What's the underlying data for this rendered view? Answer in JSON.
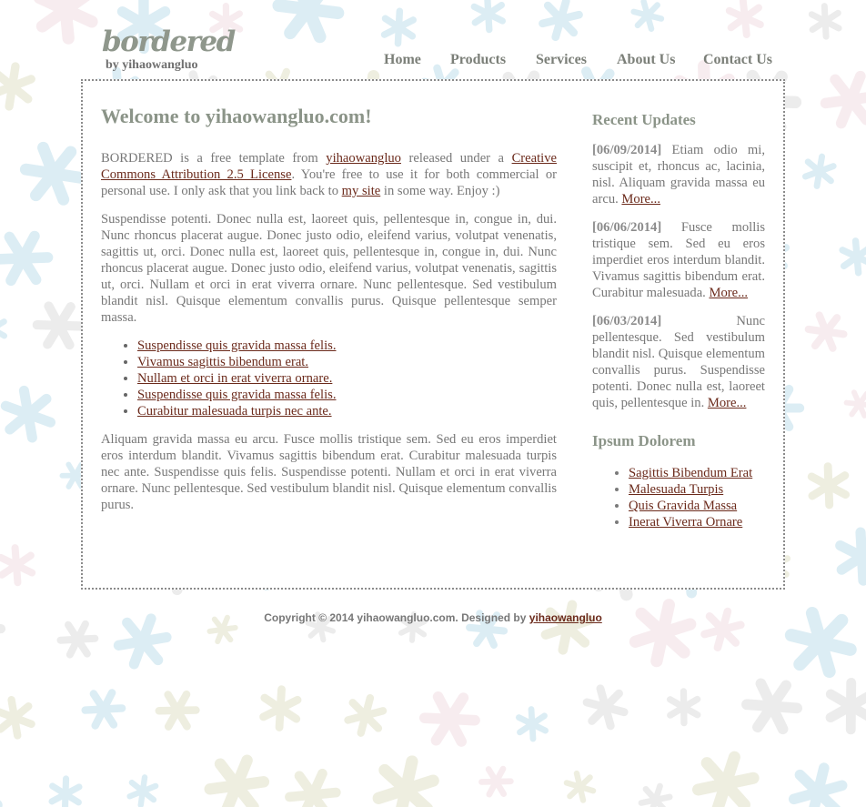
{
  "site": {
    "logo_title": "bordered",
    "logo_subtitle": "by yihaowangluo"
  },
  "nav": {
    "items": [
      {
        "label": "Home"
      },
      {
        "label": "Products"
      },
      {
        "label": "Services"
      },
      {
        "label": "About Us"
      },
      {
        "label": "Contact Us"
      }
    ]
  },
  "main": {
    "heading": "Welcome to yihaowangluo.com!",
    "intro": {
      "t1": "BORDERED is a free template from ",
      "link1": "yihaowangluo",
      "t2": " released under a ",
      "link2": "Creative Commons Attribution 2.5 License",
      "t3": ". You're free to use it for both commercial or personal use. I only ask that you link back to ",
      "link3": "my site",
      "t4": " in some way. Enjoy :)"
    },
    "paragraph2": "Suspendisse potenti. Donec nulla est, laoreet quis, pellentesque in, congue in, dui. Nunc rhoncus placerat augue. Donec justo odio, eleifend varius, volutpat venenatis, sagittis ut, orci. Donec nulla est, laoreet quis, pellentesque in, congue in, dui. Nunc rhoncus placerat augue. Donec justo odio, eleifend varius, volutpat venenatis, sagittis ut, orci. Nullam et orci in erat viverra ornare. Nunc pellentesque. Sed vestibulum blandit nisl. Quisque elementum convallis purus. Quisque pellentesque semper massa.",
    "links": [
      "Suspendisse quis gravida massa felis.",
      "Vivamus sagittis bibendum erat.",
      "Nullam et orci in erat viverra ornare.",
      "Suspendisse quis gravida massa felis.",
      "Curabitur malesuada turpis nec ante."
    ],
    "paragraph3": "Aliquam gravida massa eu arcu. Fusce mollis tristique sem. Sed eu eros imperdiet eros interdum blandit. Vivamus sagittis bibendum erat. Curabitur malesuada turpis nec ante. Suspendisse quis felis. Suspendisse potenti. Nullam et orci in erat viverra ornare. Nunc pellentesque. Sed vestibulum blandit nisl. Quisque elementum convallis purus."
  },
  "sidebar": {
    "updates_heading": "Recent Updates",
    "updates": [
      {
        "date": "[06/09/2014]",
        "text": " Etiam odio mi, suscipit et, rhoncus ac, lacinia, nisl. Aliquam gravida massa eu arcu. ",
        "more": "More..."
      },
      {
        "date": "[06/06/2014]",
        "text": " Fusce mollis tristique sem. Sed eu eros imperdiet eros interdum blandit. Vivamus sagittis bibendum erat. Curabitur malesuada. ",
        "more": "More..."
      },
      {
        "date": "[06/03/2014]",
        "text": " Nunc pellentesque. Sed vestibulum blandit nisl. Quisque elementum convallis purus. Suspendisse potenti. Donec nulla est, laoreet quis, pellentesque in. ",
        "more": "More..."
      }
    ],
    "ipsum_heading": "Ipsum Dolorem",
    "ipsum_links": [
      "Sagittis Bibendum Erat",
      "Malesuada Turpis",
      "Quis Gravida Massa",
      "Inerat Viverra Ornare"
    ]
  },
  "footer": {
    "text": "Copyright © 2014 yihaowangluo.com. Designed by ",
    "link": "yihaowangluo"
  },
  "colors": {
    "link": "#6b2a1b",
    "heading": "#8b9488",
    "text": "#777777",
    "border": "#8b8b8b",
    "pattern_blue": "#dcedf4",
    "pattern_grey": "#ececec",
    "pattern_pink": "#f7ecef",
    "pattern_cream": "#eeeee0"
  },
  "background_pattern": "asterisk-pattern"
}
